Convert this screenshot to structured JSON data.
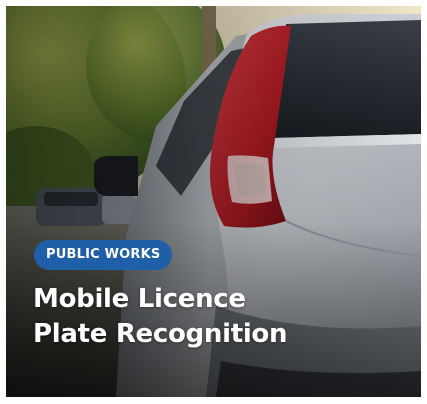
{
  "card": {
    "category": "PUBLIC WORKS",
    "title_line_1": "Mobile Licence",
    "title_line_2": "Plate Recognition"
  },
  "photo": {
    "subject": "rear of silver hatchback car with red tail light, parked near trees and other cars",
    "colors": {
      "badge": "#1f5fa8",
      "car_body": "#c9cdd2",
      "tail_light": "#c0202a",
      "foliage": "#6f8f3a",
      "sky": "#e9dcc0"
    }
  }
}
